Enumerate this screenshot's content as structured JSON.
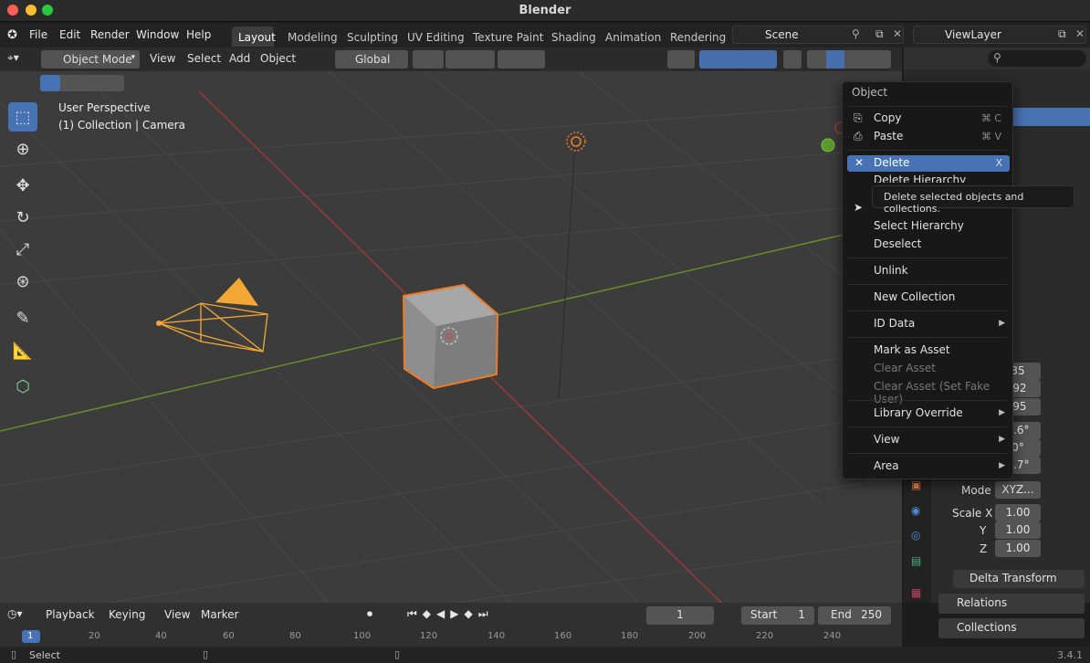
{
  "window": {
    "title": "Blender"
  },
  "menu": {
    "file": "File",
    "edit": "Edit",
    "render": "Render",
    "window": "Window",
    "help": "Help"
  },
  "workspaces": [
    "Layout",
    "Modeling",
    "Sculpting",
    "UV Editing",
    "Texture Paint",
    "Shading",
    "Animation",
    "Rendering"
  ],
  "scene": {
    "name": "Scene",
    "view_layer": "ViewLayer"
  },
  "viewport": {
    "mode": "Object Mode",
    "view": "View",
    "select": "Select",
    "add": "Add",
    "object": "Object",
    "orientation": "Global",
    "perspective": "User Perspective",
    "collection": "(1) Collection | Camera"
  },
  "context_menu": {
    "title": "Object",
    "copy": "Copy",
    "copy_shortcut": "⌘ C",
    "paste": "Paste",
    "paste_shortcut": "⌘ V",
    "delete": "Delete",
    "delete_shortcut": "X",
    "delete_hierarchy": "Delete Hierarchy",
    "select_hierarchy": "Select Hierarchy",
    "deselect": "Deselect",
    "unlink": "Unlink",
    "new_collection": "New Collection",
    "id_data": "ID Data",
    "mark_asset": "Mark as Asset",
    "clear_asset": "Clear Asset",
    "clear_asset_fake": "Clear Asset (Set Fake User)",
    "library_override": "Library Override",
    "view": "View",
    "area": "Area"
  },
  "tooltip": "Delete selected objects and collections.",
  "properties": {
    "loc_x": "35",
    "loc_y": ".92",
    "loc_z": ".95",
    "rot_x": "3.6°",
    "rot_y": "0°",
    "rot_z": "5.7°",
    "mode_label": "Mode",
    "mode_value": "XYZ...",
    "scale_x_label": "Scale X",
    "scale_y_label": "Y",
    "scale_z_label": "Z",
    "scale_x": "1.00",
    "scale_y": "1.00",
    "scale_z": "1.00",
    "delta_transform": "Delta Transform",
    "relations": "Relations",
    "collections": "Collections"
  },
  "timeline": {
    "playback": "Playback",
    "keying": "Keying",
    "view": "View",
    "marker": "Marker",
    "current_frame": "1",
    "start_label": "Start",
    "start": "1",
    "end_label": "End",
    "end": "250",
    "ticks": [
      "1",
      "20",
      "40",
      "60",
      "80",
      "100",
      "120",
      "140",
      "160",
      "180",
      "200",
      "220",
      "240"
    ]
  },
  "status": {
    "select": "Select",
    "version": "3.4.1"
  }
}
